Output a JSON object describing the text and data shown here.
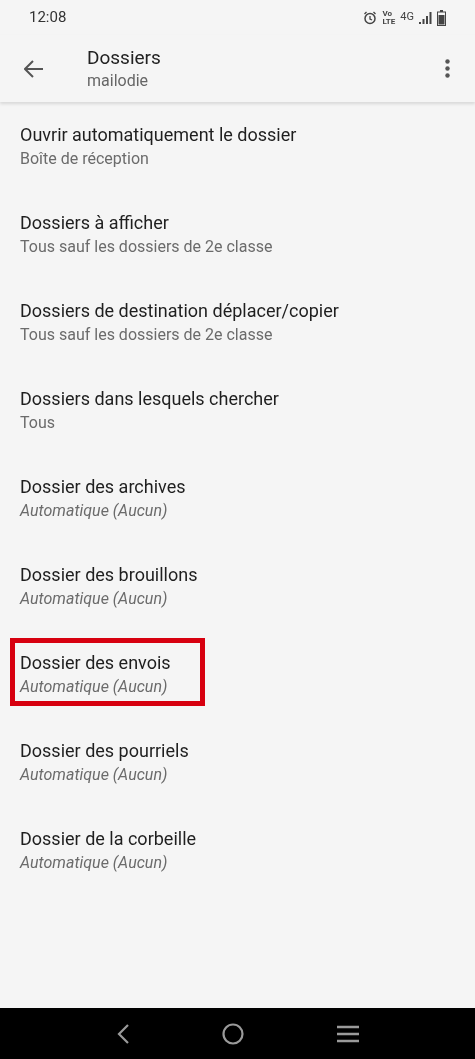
{
  "status_bar": {
    "time": "12:08",
    "volte": [
      "Vo",
      "LTE"
    ],
    "network": "4G"
  },
  "toolbar": {
    "title": "Dossiers",
    "subtitle": "mailodie"
  },
  "settings": [
    {
      "title": "Ouvrir automatiquement le dossier",
      "summary": "Boîte de réception",
      "kind": "plain",
      "highlighted": false
    },
    {
      "title": "Dossiers à afficher",
      "summary": "Tous sauf les dossiers de 2e classe",
      "kind": "plain",
      "highlighted": false
    },
    {
      "title": "Dossiers de destination déplacer/copier",
      "summary": "Tous sauf les dossiers de 2e classe",
      "kind": "plain",
      "highlighted": false
    },
    {
      "title": "Dossiers dans lesquels chercher",
      "summary": "Tous",
      "kind": "plain",
      "highlighted": false
    },
    {
      "title": "Dossier des archives",
      "summary": "Automatique (Aucun)",
      "kind": "automatic",
      "highlighted": false
    },
    {
      "title": "Dossier des brouillons",
      "summary": "Automatique (Aucun)",
      "kind": "automatic",
      "highlighted": false
    },
    {
      "title": "Dossier des envois",
      "summary": "Automatique (Aucun)",
      "kind": "automatic",
      "highlighted": true
    },
    {
      "title": "Dossier des pourriels",
      "summary": "Automatique (Aucun)",
      "kind": "automatic",
      "highlighted": false
    },
    {
      "title": "Dossier de la corbeille",
      "summary": "Automatique (Aucun)",
      "kind": "automatic",
      "highlighted": false
    }
  ]
}
